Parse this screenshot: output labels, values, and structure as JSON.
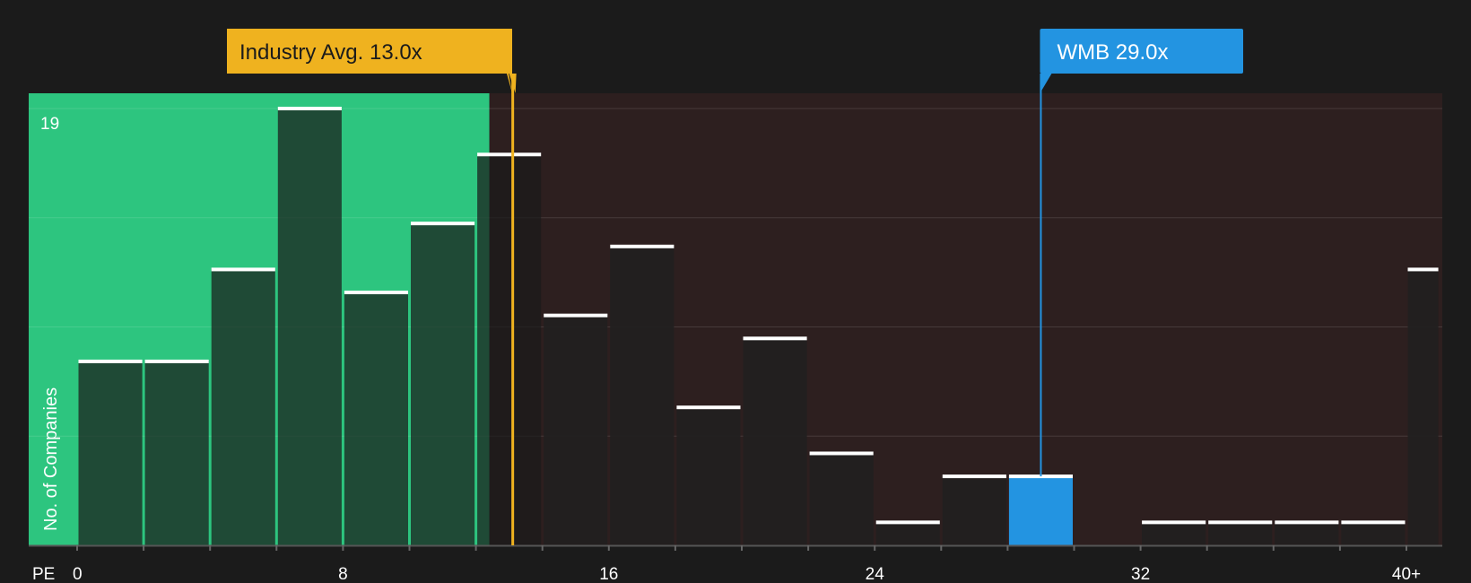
{
  "chart_data": {
    "type": "bar",
    "xlabel": "PE",
    "ylabel": "No. of Companies",
    "x_ticks": [
      "0",
      "8",
      "16",
      "24",
      "32",
      "40+"
    ],
    "y_max_label": "19",
    "ylim": [
      0,
      19
    ],
    "xlim": [
      0,
      41
    ],
    "bins": [
      {
        "x0": 0,
        "x1": 2,
        "value": 8
      },
      {
        "x0": 2,
        "x1": 4,
        "value": 8
      },
      {
        "x0": 4,
        "x1": 6,
        "value": 12
      },
      {
        "x0": 6,
        "x1": 8,
        "value": 19
      },
      {
        "x0": 8,
        "x1": 10,
        "value": 11
      },
      {
        "x0": 10,
        "x1": 12,
        "value": 14
      },
      {
        "x0": 12,
        "x1": 14,
        "value": 17
      },
      {
        "x0": 14,
        "x1": 16,
        "value": 10
      },
      {
        "x0": 16,
        "x1": 18,
        "value": 13
      },
      {
        "x0": 18,
        "x1": 20,
        "value": 6
      },
      {
        "x0": 20,
        "x1": 22,
        "value": 9
      },
      {
        "x0": 22,
        "x1": 24,
        "value": 4
      },
      {
        "x0": 24,
        "x1": 26,
        "value": 1
      },
      {
        "x0": 26,
        "x1": 28,
        "value": 3
      },
      {
        "x0": 28,
        "x1": 30,
        "value": 3,
        "highlight": true
      },
      {
        "x0": 30,
        "x1": 32,
        "value": 0
      },
      {
        "x0": 32,
        "x1": 34,
        "value": 1
      },
      {
        "x0": 34,
        "x1": 36,
        "value": 1
      },
      {
        "x0": 36,
        "x1": 38,
        "value": 1
      },
      {
        "x0": 38,
        "x1": 40,
        "value": 1
      },
      {
        "x0": 40,
        "x1": 41,
        "value": 12
      }
    ],
    "industry_avg": {
      "label": "Industry Avg. 13.0x",
      "value": 13.0,
      "color": "#efb21f"
    },
    "company": {
      "label": "WMB 29.0x",
      "value": 29.0,
      "color": "#2394e1"
    },
    "colors": {
      "background": "#1b1b1b",
      "below_region": "#2dc57f",
      "above_region": "#2d1f1f",
      "highlight_bar": "#2394e1"
    }
  }
}
